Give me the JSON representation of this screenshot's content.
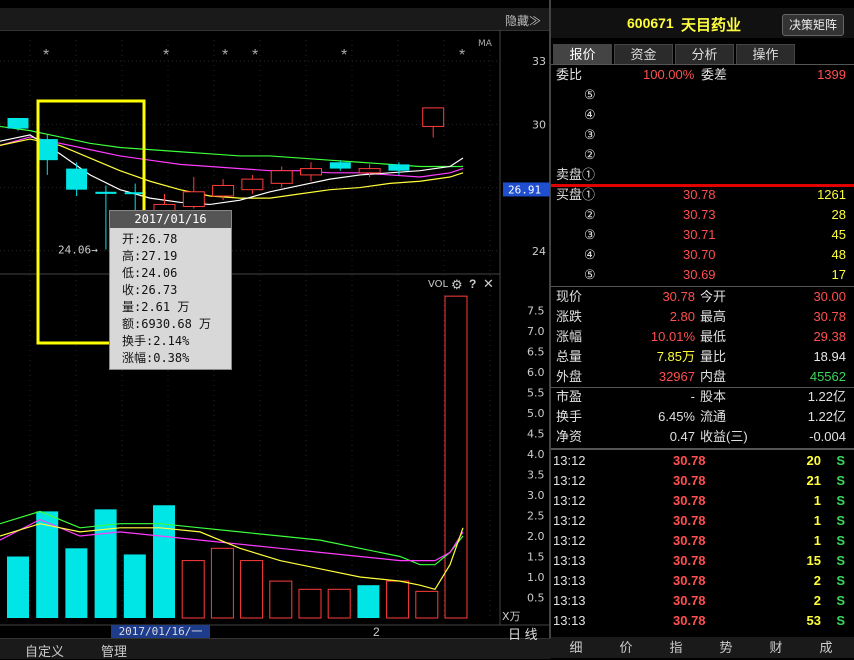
{
  "toolbar": {
    "hide_label": "隐藏≫"
  },
  "stock": {
    "code": "600671",
    "name": "天目药业",
    "decision_button": "决策矩阵"
  },
  "tabs": [
    "报价",
    "资金",
    "分析",
    "操作"
  ],
  "weibi": {
    "label": "委比",
    "value": "100.00%",
    "diff_label": "委差",
    "diff_value": "1399"
  },
  "sell_levels": [
    {
      "label": "⑤"
    },
    {
      "label": "④"
    },
    {
      "label": "③"
    },
    {
      "label": "②"
    },
    {
      "label": "卖盘①"
    }
  ],
  "buy_levels": [
    {
      "label": "买盘①",
      "price": "30.78",
      "vol": "1261"
    },
    {
      "label": "②",
      "price": "30.73",
      "vol": "28"
    },
    {
      "label": "③",
      "price": "30.71",
      "vol": "45"
    },
    {
      "label": "④",
      "price": "30.70",
      "vol": "48"
    },
    {
      "label": "⑤",
      "price": "30.69",
      "vol": "17"
    }
  ],
  "stats": [
    {
      "l1": "现价",
      "v1": "30.78",
      "c1": "red",
      "l2": "今开",
      "v2": "30.00",
      "c2": "red"
    },
    {
      "l1": "涨跌",
      "v1": "2.80",
      "c1": "red",
      "l2": "最高",
      "v2": "30.78",
      "c2": "red"
    },
    {
      "l1": "涨幅",
      "v1": "10.01%",
      "c1": "red",
      "l2": "最低",
      "v2": "29.38",
      "c2": "red"
    },
    {
      "l1": "总量",
      "v1": "7.85万",
      "c1": "yellow",
      "l2": "量比",
      "v2": "18.94",
      "c2": "white"
    },
    {
      "l1": "外盘",
      "v1": "32967",
      "c1": "red",
      "l2": "内盘",
      "v2": "45562",
      "c2": "green"
    }
  ],
  "fundamentals": [
    {
      "l1": "市盈",
      "v1": "-",
      "l2": "股本",
      "v2": "1.22亿"
    },
    {
      "l1": "换手",
      "v1": "6.45%",
      "l2": "流通",
      "v2": "1.22亿"
    },
    {
      "l1": "净资",
      "v1": "0.47",
      "l2": "收益(三)",
      "v2": "-0.004"
    }
  ],
  "ticks": [
    {
      "time": "13:12",
      "price": "30.78",
      "vol": "20",
      "side": "S"
    },
    {
      "time": "13:12",
      "price": "30.78",
      "vol": "21",
      "side": "S"
    },
    {
      "time": "13:12",
      "price": "30.78",
      "vol": "1",
      "side": "S"
    },
    {
      "time": "13:12",
      "price": "30.78",
      "vol": "1",
      "side": "S"
    },
    {
      "time": "13:12",
      "price": "30.78",
      "vol": "1",
      "side": "S"
    },
    {
      "time": "13:13",
      "price": "30.78",
      "vol": "15",
      "side": "S"
    },
    {
      "time": "13:13",
      "price": "30.78",
      "vol": "2",
      "side": "S"
    },
    {
      "time": "13:13",
      "price": "30.78",
      "vol": "2",
      "side": "S"
    },
    {
      "time": "13:13",
      "price": "30.78",
      "vol": "53",
      "side": "S"
    }
  ],
  "bottom_tabs": [
    "细",
    "价",
    "指",
    "势",
    "财",
    "成"
  ],
  "bottom_left": {
    "custom": "自定义",
    "manage": "管理",
    "date": "2017/01/16/一",
    "page": "2",
    "period": "日 线"
  },
  "tooltip": {
    "date": "2017/01/16",
    "rows": [
      {
        "label": "开:",
        "value": "26.78"
      },
      {
        "label": "高:",
        "value": "27.19"
      },
      {
        "label": "低:",
        "value": "24.06"
      },
      {
        "label": "收:",
        "value": "26.73"
      },
      {
        "label": "量:",
        "value": "2.61 万"
      },
      {
        "label": "额:",
        "value": "6930.68 万"
      },
      {
        "label": "换手:",
        "value": "2.14%"
      },
      {
        "label": "涨幅:",
        "value": "0.38%"
      }
    ]
  },
  "chart_data": {
    "type": "candlestick",
    "price_axis": {
      "ticks": [
        33,
        30,
        27,
        24
      ],
      "current": "26.91"
    },
    "ma_label": "MA",
    "low_annotation": "24.06",
    "candles": [
      {
        "o": 29.8,
        "c": 30.3,
        "h": 30.3,
        "l": 29.7,
        "color": "cyan"
      },
      {
        "o": 29.3,
        "c": 28.3,
        "h": 29.5,
        "l": 27.6,
        "color": "cyan"
      },
      {
        "o": 27.9,
        "c": 26.9,
        "h": 28.2,
        "l": 26.6,
        "color": "cyan"
      },
      {
        "o": 26.8,
        "c": 26.7,
        "h": 27.1,
        "l": 24.06,
        "color": "cyan"
      },
      {
        "o": 26.78,
        "c": 26.73,
        "h": 27.19,
        "l": 24.06,
        "color": "cyan"
      },
      {
        "o": 25.8,
        "c": 26.2,
        "h": 26.7,
        "l": 25.3,
        "color": "red"
      },
      {
        "o": 26.1,
        "c": 26.8,
        "h": 27.5,
        "l": 26.0,
        "color": "red"
      },
      {
        "o": 26.6,
        "c": 27.1,
        "h": 27.4,
        "l": 26.4,
        "color": "red"
      },
      {
        "o": 26.9,
        "c": 27.4,
        "h": 27.6,
        "l": 26.7,
        "color": "red"
      },
      {
        "o": 27.2,
        "c": 27.8,
        "h": 28.0,
        "l": 27.0,
        "color": "red"
      },
      {
        "o": 27.6,
        "c": 27.9,
        "h": 28.2,
        "l": 27.3,
        "color": "red"
      },
      {
        "o": 28.2,
        "c": 27.9,
        "h": 28.3,
        "l": 27.8,
        "color": "cyan"
      },
      {
        "o": 27.7,
        "c": 27.9,
        "h": 28.1,
        "l": 27.5,
        "color": "red"
      },
      {
        "o": 27.8,
        "c": 28.1,
        "h": 28.2,
        "l": 27.6,
        "color": "cyan"
      },
      {
        "o": 29.9,
        "c": 30.78,
        "h": 30.78,
        "l": 29.38,
        "color": "red"
      }
    ],
    "volume_axis": {
      "ticks": [
        "7.5",
        "7.0",
        "6.5",
        "6.0",
        "5.5",
        "5.0",
        "4.5",
        "4.0",
        "3.5",
        "3.0",
        "2.5",
        "2.0",
        "1.5",
        "1.0",
        "0.5"
      ],
      "unit": "X万",
      "label": "VOL"
    },
    "volumes": [
      {
        "v": 1.5,
        "color": "cyan"
      },
      {
        "v": 2.6,
        "color": "cyan"
      },
      {
        "v": 1.7,
        "color": "cyan"
      },
      {
        "v": 2.65,
        "color": "cyan"
      },
      {
        "v": 1.55,
        "color": "cyan"
      },
      {
        "v": 2.75,
        "color": "cyan"
      },
      {
        "v": 1.4,
        "color": "red"
      },
      {
        "v": 1.7,
        "color": "red"
      },
      {
        "v": 1.4,
        "color": "red"
      },
      {
        "v": 0.9,
        "color": "red"
      },
      {
        "v": 0.7,
        "color": "red"
      },
      {
        "v": 0.7,
        "color": "red"
      },
      {
        "v": 0.8,
        "color": "cyan"
      },
      {
        "v": 0.9,
        "color": "red"
      },
      {
        "v": 0.65,
        "color": "red"
      },
      {
        "v": 7.85,
        "color": "red"
      }
    ],
    "colors": {
      "up": "#ff3c3c",
      "down": "#00e5e5",
      "ma5": "#ffffff",
      "ma10": "#ffff3c",
      "ma20": "#ff3cff",
      "ma60": "#3cff3c"
    }
  }
}
